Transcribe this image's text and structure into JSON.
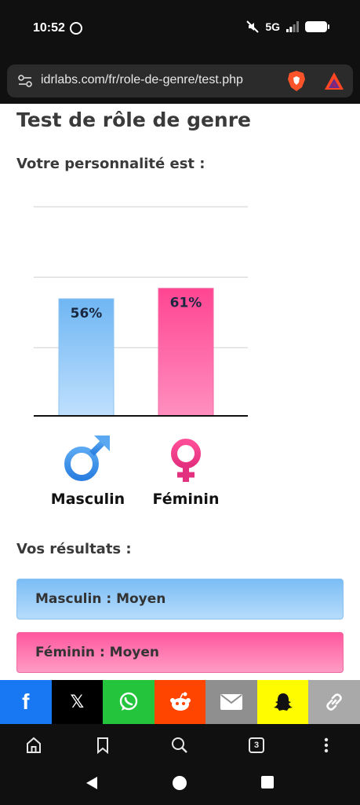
{
  "status": {
    "time": "10:52",
    "network": "5G"
  },
  "browser": {
    "url": "idrlabs.com/fr/role-de-genre/test.php",
    "tab_count": "3"
  },
  "page": {
    "title": "Test de rôle de genre",
    "subtitle": "Votre personnalité est :",
    "results_heading": "Vos résultats :",
    "results": [
      {
        "text": "Masculin : Moyen"
      },
      {
        "text": "Féminin : Moyen"
      }
    ]
  },
  "chart_data": {
    "type": "bar",
    "categories": [
      "Masculin",
      "Féminin"
    ],
    "values": [
      56,
      61
    ],
    "value_labels": [
      "56%",
      "61%"
    ],
    "ylim": [
      0,
      100
    ],
    "grid": true,
    "colors": [
      "#7bbdf5",
      "#ff579e"
    ]
  },
  "colors": {
    "masculine": "#7bbdf5",
    "feminine": "#ff579e",
    "text": "#3a3a3a",
    "system_bar": "#101010"
  },
  "share": [
    {
      "name": "facebook",
      "color": "#1877f2",
      "glyph": "f"
    },
    {
      "name": "x",
      "color": "#000000",
      "glyph": "𝕏"
    },
    {
      "name": "whatsapp",
      "color": "#25c43d",
      "glyph": ""
    },
    {
      "name": "reddit",
      "color": "#ff4500",
      "glyph": ""
    },
    {
      "name": "email",
      "color": "#8f8f8f",
      "glyph": ""
    },
    {
      "name": "snapchat",
      "color": "#fffc00",
      "glyph": ""
    },
    {
      "name": "copy-link",
      "color": "#a9a9a9",
      "glyph": ""
    }
  ]
}
